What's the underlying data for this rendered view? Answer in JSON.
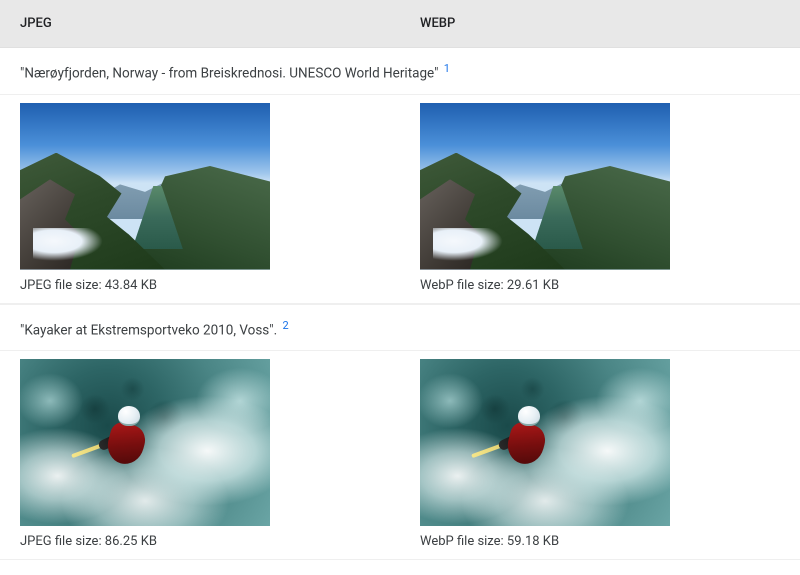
{
  "headers": {
    "jpeg": "JPEG",
    "webp": "WEBP"
  },
  "rows": [
    {
      "caption": "\"Nærøyfjorden, Norway - from Breiskrednosi. UNESCO World Heritage\"",
      "footnote": "1",
      "jpeg_size": "JPEG file size: 43.84 KB",
      "webp_size": "WebP file size: 29.61 KB"
    },
    {
      "caption": "\"Kayaker at Ekstremsportveko 2010, Voss\".",
      "footnote": "2",
      "jpeg_size": "JPEG file size: 86.25 KB",
      "webp_size": "WebP file size: 59.18 KB"
    }
  ]
}
